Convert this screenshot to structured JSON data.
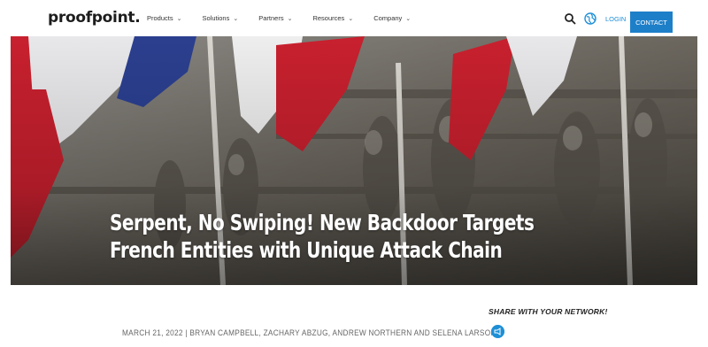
{
  "header": {
    "logo": "proofpoint.",
    "nav": [
      {
        "label": "Products"
      },
      {
        "label": "Solutions"
      },
      {
        "label": "Partners"
      },
      {
        "label": "Resources"
      },
      {
        "label": "Company"
      }
    ],
    "login": "LOGIN",
    "contact": "CONTACT",
    "icons": {
      "search": "search-icon",
      "globe": "globe-icon"
    },
    "colors": {
      "accent": "#1e7fc9",
      "link": "#1e8fd6"
    }
  },
  "hero": {
    "title_line1": "Serpent, No Swiping! New Backdoor Targets",
    "title_line2": "French Entities with Unique Attack Chain"
  },
  "article": {
    "share_label": "SHARE WITH YOUR NETWORK!",
    "meta": "MARCH 21, 2022  |  BRYAN CAMPBELL, ZACHARY ABZUG, ANDREW NORTHERN AND SELENA LARSON",
    "share_icon": "share-megaphone-icon"
  }
}
